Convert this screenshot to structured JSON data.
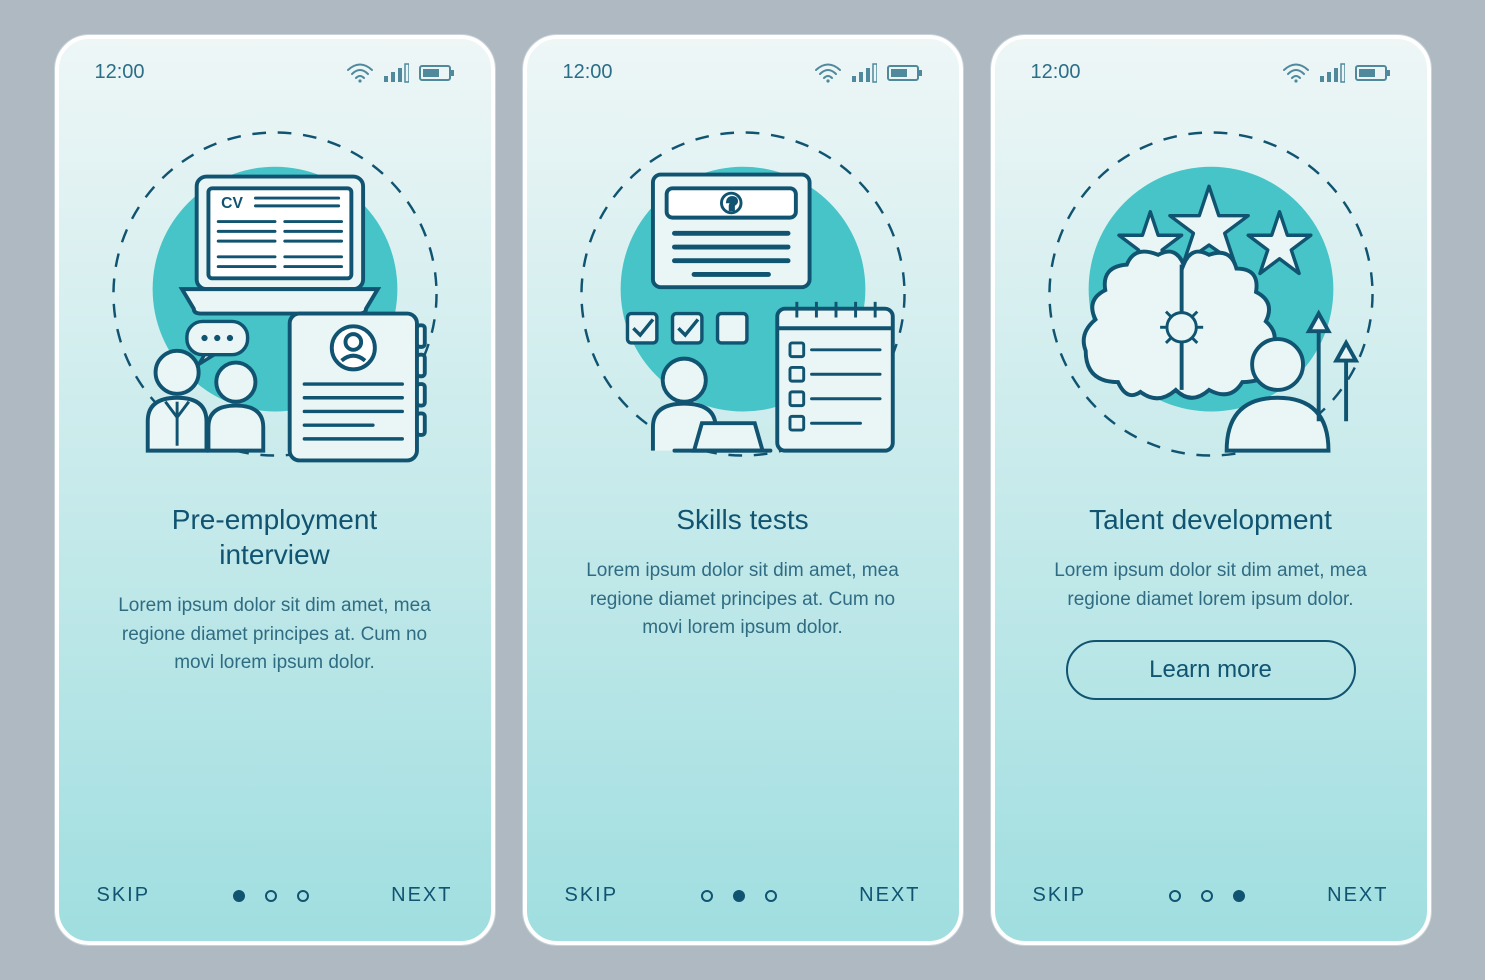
{
  "status": {
    "time": "12:00"
  },
  "screens": [
    {
      "title": "Pre-employment interview",
      "body": "Lorem ipsum dolor sit dim amet, mea regione diamet principes at. Cum no movi lorem ipsum dolor.",
      "skip": "SKIP",
      "next": "NEXT",
      "activeDot": 0,
      "cta": null
    },
    {
      "title": "Skills tests",
      "body": "Lorem ipsum dolor sit dim amet, mea regione diamet principes at. Cum no movi lorem ipsum dolor.",
      "skip": "SKIP",
      "next": "NEXT",
      "activeDot": 1,
      "cta": null
    },
    {
      "title": "Talent development",
      "body": "Lorem ipsum dolor sit dim amet, mea regione diamet lorem ipsum dolor.",
      "skip": "SKIP",
      "next": "NEXT",
      "activeDot": 2,
      "cta": "Learn more"
    }
  ],
  "colors": {
    "accent": "#46c4c7",
    "stroke": "#105471"
  }
}
